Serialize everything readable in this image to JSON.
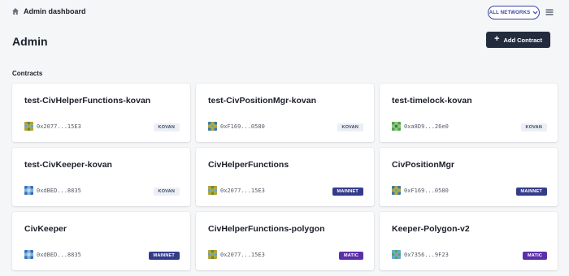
{
  "header": {
    "breadcrumb_title": "Admin dashboard",
    "network_button": "ALL NETWORKS"
  },
  "page": {
    "title": "Admin",
    "add_button": "Add Contract",
    "section_title": "Contracts"
  },
  "colors": {
    "kovan_badge_bg": "#eceff5",
    "mainnet_badge_bg": "#343c8a",
    "matic_badge_bg": "#5b2fa8",
    "primary_button": "#232b3e",
    "network_accent": "#3a46a8"
  },
  "contracts": [
    {
      "name": "test-CivHelperFunctions-kovan",
      "address": "0x2077...15E3",
      "network": "KOVAN",
      "network_class": "kovan",
      "identicon": [
        "#b8a02a",
        "#5f8f2e",
        "#b8a02a",
        "#6aa4c8",
        "#b8a02a",
        "#6aa4c8",
        "#b8a02a",
        "#5f8f2e",
        "#b8a02a"
      ]
    },
    {
      "name": "test-CivPositionMgr-kovan",
      "address": "0xF169...0580",
      "network": "KOVAN",
      "network_class": "kovan",
      "identicon": [
        "#3c7a9a",
        "#b7a43a",
        "#3c7a9a",
        "#b7a43a",
        "#6bb06a",
        "#b7a43a",
        "#3c7a9a",
        "#b7a43a",
        "#3c7a9a"
      ]
    },
    {
      "name": "test-timelock-kovan",
      "address": "0xa8D9...26e0",
      "network": "KOVAN",
      "network_class": "kovan",
      "identicon": [
        "#4fa04a",
        "#8ecb7c",
        "#4fa04a",
        "#8ecb7c",
        "#3a7d4a",
        "#8ecb7c",
        "#4fa04a",
        "#8ecb7c",
        "#4fa04a"
      ]
    },
    {
      "name": "test-CivKeeper-kovan",
      "address": "0xdBED...8835",
      "network": "KOVAN",
      "network_class": "kovan",
      "identicon": [
        "#3a6fb0",
        "#7fb3e0",
        "#3a6fb0",
        "#7fb3e0",
        "#c5d9ee",
        "#7fb3e0",
        "#3a6fb0",
        "#7fb3e0",
        "#3a6fb0"
      ]
    },
    {
      "name": "CivHelperFunctions",
      "address": "0x2077...15E3",
      "network": "MAINNET",
      "network_class": "mainnet",
      "identicon": [
        "#b8a02a",
        "#5f8f2e",
        "#b8a02a",
        "#6aa4c8",
        "#b8a02a",
        "#6aa4c8",
        "#b8a02a",
        "#5f8f2e",
        "#b8a02a"
      ]
    },
    {
      "name": "CivPositionMgr",
      "address": "0xF169...0580",
      "network": "MAINNET",
      "network_class": "mainnet",
      "identicon": [
        "#3c7a9a",
        "#b7a43a",
        "#3c7a9a",
        "#b7a43a",
        "#6bb06a",
        "#b7a43a",
        "#3c7a9a",
        "#b7a43a",
        "#3c7a9a"
      ]
    },
    {
      "name": "CivKeeper",
      "address": "0xdBED...8835",
      "network": "MAINNET",
      "network_class": "mainnet",
      "identicon": [
        "#3a6fb0",
        "#7fb3e0",
        "#3a6fb0",
        "#7fb3e0",
        "#c5d9ee",
        "#7fb3e0",
        "#3a6fb0",
        "#7fb3e0",
        "#3a6fb0"
      ]
    },
    {
      "name": "CivHelperFunctions-polygon",
      "address": "0x2077...15E3",
      "network": "MATIC",
      "network_class": "matic",
      "identicon": [
        "#b8a02a",
        "#5f8f2e",
        "#b8a02a",
        "#6aa4c8",
        "#b8a02a",
        "#6aa4c8",
        "#b8a02a",
        "#5f8f2e",
        "#b8a02a"
      ]
    },
    {
      "name": "Keeper-Polygon-v2",
      "address": "0x7356...9F23",
      "network": "MATIC",
      "network_class": "matic",
      "identicon": [
        "#6aa0d8",
        "#3fae6a",
        "#6aa0d8",
        "#3fae6a",
        "#c07ad0",
        "#3fae6a",
        "#6aa0d8",
        "#3fae6a",
        "#6aa0d8"
      ]
    }
  ]
}
